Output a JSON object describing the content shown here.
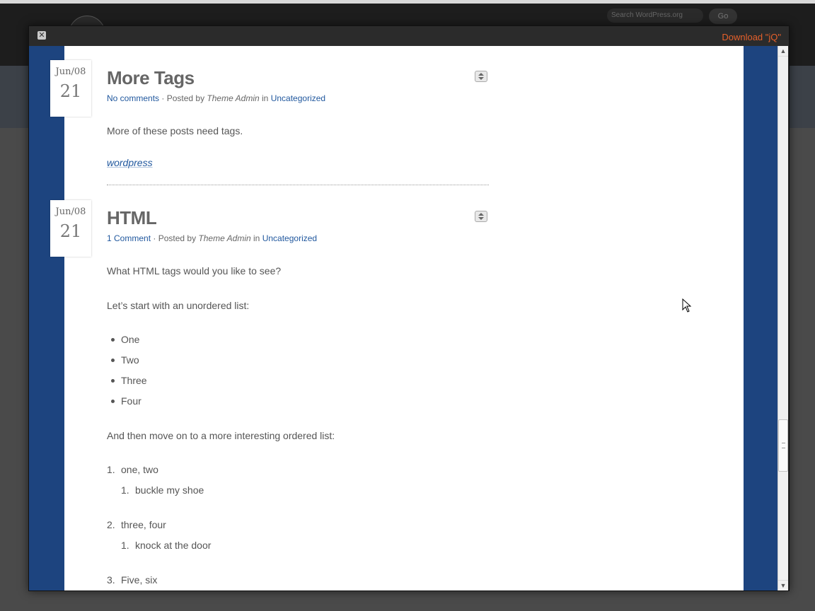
{
  "background": {
    "search_placeholder": "Search WordPress.org",
    "go_label": "Go"
  },
  "overlay": {
    "close_label": "✕",
    "download_label": "Download \"jQ\""
  },
  "posts": [
    {
      "date_month": "Jun/08",
      "date_day": "21",
      "title": "More Tags",
      "comments": "No comments",
      "posted_by": "· Posted by",
      "author": "Theme Admin",
      "in": "in",
      "category": "Uncategorized",
      "body": "More of these posts need tags.",
      "tag": "wordpress"
    },
    {
      "date_month": "Jun/08",
      "date_day": "21",
      "title": "HTML",
      "comments": "1 Comment",
      "posted_by": "· Posted by",
      "author": "Theme Admin",
      "in": "in",
      "category": "Uncategorized",
      "intro": "What HTML tags would you like to see?",
      "unordered_intro": "Let’s start with an unordered list:",
      "unordered_items": [
        "One",
        "Two",
        "Three",
        "Four"
      ],
      "ordered_intro": "And then move on to a more interesting ordered list:",
      "ordered_items": [
        {
          "num": "1.",
          "text": "one, two",
          "sub_num": "1.",
          "sub_text": "buckle my shoe"
        },
        {
          "num": "2.",
          "text": "three, four",
          "sub_num": "1.",
          "sub_text": "knock at the door"
        },
        {
          "num": "3.",
          "text": "Five, six"
        }
      ]
    }
  ],
  "scrollbar": {
    "up_icon": "▲",
    "down_icon": "▼"
  }
}
